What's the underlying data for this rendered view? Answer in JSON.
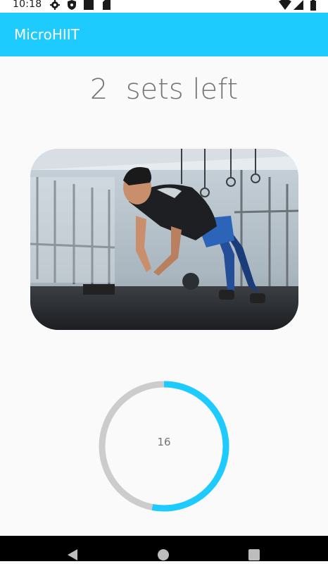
{
  "status_bar": {
    "time": "10:18",
    "icons": [
      "gear-icon",
      "shield-icon",
      "notification-square-icon",
      "sd-card-icon",
      "wifi-icon",
      "signal-icon",
      "battery-icon"
    ]
  },
  "app_bar": {
    "title": "MicroHIIT",
    "color": "#1ecbff"
  },
  "workout": {
    "sets_label": "2  sets left",
    "image": "person doing clap push-up in gym"
  },
  "timer": {
    "value": "16",
    "progress": 0.53,
    "progress_color": "#1ecbff",
    "track_color": "#cccccc"
  },
  "nav_bar": {
    "buttons": [
      "back-icon",
      "home-icon",
      "recents-icon"
    ]
  }
}
